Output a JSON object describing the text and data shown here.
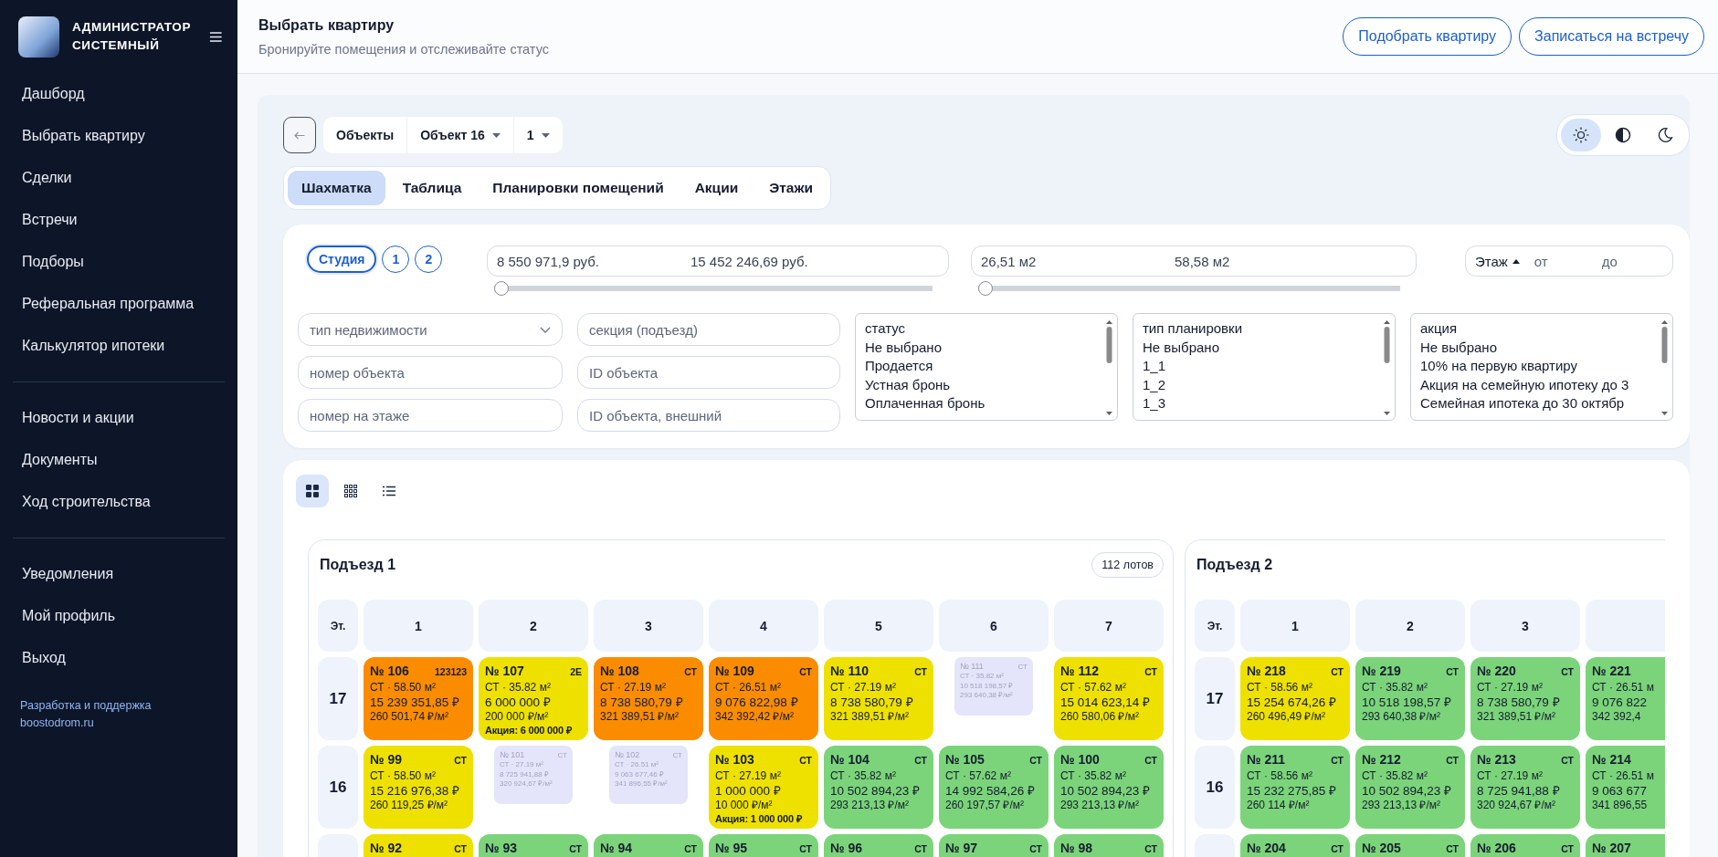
{
  "sidebar": {
    "user_name": "АДМИНИСТРАТОР СИСТЕМНЫЙ",
    "groups": [
      [
        {
          "label": "Дашборд"
        },
        {
          "label": "Выбрать квартиру"
        },
        {
          "label": "Сделки"
        },
        {
          "label": "Встречи"
        },
        {
          "label": "Подборы"
        },
        {
          "label": "Реферальная программа"
        },
        {
          "label": "Калькулятор ипотеки"
        }
      ],
      [
        {
          "label": "Новости и акции"
        },
        {
          "label": "Документы"
        },
        {
          "label": "Ход строительства"
        }
      ],
      [
        {
          "label": "Уведомления"
        },
        {
          "label": "Мой профиль"
        },
        {
          "label": "Выход"
        }
      ]
    ],
    "footer_link": "Разработка и поддержка boostodrom.ru"
  },
  "header": {
    "title": "Выбрать квартиру",
    "subtitle": "Бронируйте помещения и отслеживайте статус",
    "buttons": [
      "Подобрать квартиру",
      "Записаться на встречу"
    ]
  },
  "breadcrumb": [
    {
      "label": "Объекты",
      "dropdown": false
    },
    {
      "label": "Объект 16",
      "dropdown": true
    },
    {
      "label": "1",
      "dropdown": true
    }
  ],
  "themes": [
    {
      "kind": "sun",
      "selected": true
    },
    {
      "kind": "contrast",
      "selected": false
    },
    {
      "kind": "moon",
      "selected": false
    }
  ],
  "tabs": [
    {
      "label": "Шахматка",
      "selected": true
    },
    {
      "label": "Таблица",
      "selected": false
    },
    {
      "label": "Планировки помещений",
      "selected": false
    },
    {
      "label": "Акции",
      "selected": false
    },
    {
      "label": "Этажи",
      "selected": false
    }
  ],
  "filters": {
    "room_chips": [
      {
        "label": "Студия",
        "selected": true
      },
      {
        "label": "1",
        "selected": false
      },
      {
        "label": "2",
        "selected": false
      }
    ],
    "price_range": {
      "min": "8 550 971,9 руб.",
      "max": "15 452 246,69 руб.",
      "level": 0
    },
    "area_range": {
      "min": "26,51 м2",
      "max": "58,58 м2",
      "level": 0
    },
    "floor": {
      "label": "Этаж",
      "from_placeholder": "от",
      "to_placeholder": "до"
    },
    "fields": [
      {
        "kind": "select",
        "placeholder": "тип недвижимости"
      },
      {
        "kind": "input",
        "placeholder": "секция (подъезд)"
      },
      {
        "kind": "input",
        "placeholder": "номер объекта"
      },
      {
        "kind": "input",
        "placeholder": "ID объекта"
      },
      {
        "kind": "input",
        "placeholder": "номер на этаже"
      },
      {
        "kind": "input",
        "placeholder": "ID объекта, внешний"
      }
    ],
    "listboxes": [
      {
        "options": [
          "статус",
          "Не выбрано",
          "Продается",
          "Устная бронь",
          "Оплаченная бронь"
        ]
      },
      {
        "options": [
          "тип планировки",
          "Не выбрано",
          "1_1",
          "1_2",
          "1_3"
        ]
      },
      {
        "options": [
          "акция",
          "Не выбрано",
          "10% на первую квартиру",
          "Акция на семейную ипотеку до 3",
          "Семейная ипотека до 30 октябр"
        ]
      }
    ]
  },
  "view_modes": [
    {
      "kind": "grid",
      "selected": true
    },
    {
      "kind": "dense-grid",
      "selected": false
    },
    {
      "kind": "list",
      "selected": false
    }
  ],
  "sections": [
    {
      "title": "Подъезд 1",
      "badge": "112 лотов",
      "floor_header": "Эт.",
      "columns": [
        "1",
        "2",
        "3",
        "4",
        "5",
        "6",
        "7"
      ],
      "rows": [
        {
          "floor": "17",
          "lots": [
            {
              "number": "№ 106",
              "tag": "123123",
              "area": "СТ · 58.50 м²",
              "price": "15 239 351,85 ₽",
              "per_m2": "260 501,74 ₽/м²",
              "color": "#fb8c00",
              "disabled": false
            },
            {
              "number": "№ 107",
              "tag": "2Е",
              "area": "СТ · 35.82 м²",
              "price": "6 000 000 ₽",
              "per_m2": "200 000 ₽/м²",
              "promo": "Акция: 6 000 000 ₽",
              "color": "#eee100",
              "disabled": false
            },
            {
              "number": "№ 108",
              "tag": "СТ",
              "area": "СТ · 27.19 м²",
              "price": "8 738 580,79 ₽",
              "per_m2": "321 389,51 ₽/м²",
              "color": "#fb8c00",
              "disabled": false
            },
            {
              "number": "№ 109",
              "tag": "СТ",
              "area": "СТ · 26.51 м²",
              "price": "9 076 822,98 ₽",
              "per_m2": "342 392,42 ₽/м²",
              "color": "#fb8c00",
              "disabled": false
            },
            {
              "number": "№ 110",
              "tag": "СТ",
              "area": "СТ · 27.19 м²",
              "price": "8 738 580,79 ₽",
              "per_m2": "321 389,51 ₽/м²",
              "color": "#eee100",
              "disabled": false
            },
            {
              "number": "№ 111",
              "tag": "СТ",
              "area": "СТ · 35.82 м²",
              "price": "10 518 198,57 ₽",
              "per_m2": "293 640,38 ₽/м²",
              "color": "#e4e4fb",
              "disabled": true
            },
            {
              "number": "№ 112",
              "tag": "СТ",
              "area": "СТ · 57.62 м²",
              "price": "15 014 623,14 ₽",
              "per_m2": "260 580,06 ₽/м²",
              "color": "#eee100",
              "disabled": false
            }
          ]
        },
        {
          "floor": "16",
          "lots": [
            {
              "number": "№ 99",
              "tag": "СТ",
              "area": "СТ · 58.50 м²",
              "price": "15 216 976,38 ₽",
              "per_m2": "260 119,25 ₽/м²",
              "color": "#eee100",
              "disabled": false
            },
            {
              "number": "№ 101",
              "tag": "СТ",
              "area": "СТ · 27.19 м²",
              "price": "8 725 941,88 ₽",
              "per_m2": "320 924,67 ₽/м²",
              "color": "#e4e4fb",
              "disabled": true
            },
            {
              "number": "№ 102",
              "tag": "СТ",
              "area": "СТ · 26.51 м²",
              "price": "9 063 677,46 ₽",
              "per_m2": "341 896,55 ₽/м²",
              "color": "#e4e4fb",
              "disabled": true
            },
            {
              "number": "№ 103",
              "tag": "СТ",
              "area": "СТ · 27.19 м²",
              "price": "1 000 000 ₽",
              "per_m2": "10 000 ₽/м²",
              "promo": "Акция: 1 000 000 ₽",
              "color": "#eee100",
              "disabled": false
            },
            {
              "number": "№ 104",
              "tag": "СТ",
              "area": "СТ · 35.82 м²",
              "price": "10 502 894,23 ₽",
              "per_m2": "293 213,13 ₽/м²",
              "color": "#7bd47a",
              "disabled": false
            },
            {
              "number": "№ 105",
              "tag": "СТ",
              "area": "СТ · 57.62 м²",
              "price": "14 992 584,26 ₽",
              "per_m2": "260 197,57 ₽/м²",
              "color": "#7bd47a",
              "disabled": false
            },
            {
              "number": "№ 100",
              "tag": "СТ",
              "area": "СТ · 35.82 м²",
              "price": "10 502 894,23 ₽",
              "per_m2": "293 213,13 ₽/м²",
              "color": "#7bd47a",
              "disabled": false
            }
          ]
        },
        {
          "lots": [
            {
              "number": "№ 92",
              "tag": "СТ",
              "color": "#eee100",
              "disabled": false
            },
            {
              "number": "№ 93",
              "tag": "СТ",
              "color": "#7bd47a",
              "disabled": false
            },
            {
              "number": "№ 94",
              "tag": "СТ",
              "color": "#7bd47a",
              "disabled": false
            },
            {
              "number": "№ 95",
              "tag": "СТ",
              "color": "#7bd47a",
              "disabled": false
            },
            {
              "number": "№ 96",
              "tag": "СТ",
              "color": "#7bd47a",
              "disabled": false
            },
            {
              "number": "№ 97",
              "tag": "СТ",
              "color": "#7bd47a",
              "disabled": false
            },
            {
              "number": "№ 98",
              "tag": "СТ",
              "color": "#7bd47a",
              "disabled": false
            }
          ]
        }
      ]
    },
    {
      "title": "Подъезд 2",
      "floor_header": "Эт.",
      "columns": [
        "1",
        "2",
        "3"
      ],
      "rows": [
        {
          "floor": "17",
          "lots": [
            {
              "number": "№ 218",
              "tag": "СТ",
              "area": "СТ · 58.56 м²",
              "price": "15 254 674,26 ₽",
              "per_m2": "260 496,49 ₽/м²",
              "color": "#eee100",
              "disabled": false
            },
            {
              "number": "№ 219",
              "tag": "СТ",
              "area": "СТ · 35.82 м²",
              "price": "10 518 198,57 ₽",
              "per_m2": "293 640,38 ₽/м²",
              "color": "#7bd47a",
              "disabled": false
            },
            {
              "number": "№ 220",
              "tag": "СТ",
              "area": "СТ · 27.19 м²",
              "price": "8 738 580,79 ₽",
              "per_m2": "321 389,51 ₽/м²",
              "color": "#7bd47a",
              "disabled": false
            },
            {
              "number": "№ 221",
              "area": "СТ · 26.51 м",
              "price": "9 076 822",
              "per_m2": "342 392,4",
              "color": "#7bd47a",
              "disabled": false
            }
          ]
        },
        {
          "floor": "16",
          "lots": [
            {
              "number": "№ 211",
              "tag": "СТ",
              "area": "СТ · 58.56 м²",
              "price": "15 232 275,85 ₽",
              "per_m2": "260 114 ₽/м²",
              "color": "#7bd47a",
              "disabled": false
            },
            {
              "number": "№ 212",
              "tag": "СТ",
              "area": "СТ · 35.82 м²",
              "price": "10 502 894,23 ₽",
              "per_m2": "293 213,13 ₽/м²",
              "color": "#7bd47a",
              "disabled": false
            },
            {
              "number": "№ 213",
              "tag": "СТ",
              "area": "СТ · 27.19 м²",
              "price": "8 725 941,88 ₽",
              "per_m2": "320 924,67 ₽/м²",
              "color": "#7bd47a",
              "disabled": false
            },
            {
              "number": "№ 214",
              "area": "СТ · 26.51 м",
              "price": "9 063 677",
              "per_m2": "341 896,55",
              "color": "#7bd47a",
              "disabled": false
            }
          ]
        },
        {
          "lots": [
            {
              "number": "№ 204",
              "tag": "СТ",
              "color": "#7bd47a",
              "disabled": false
            },
            {
              "number": "№ 205",
              "tag": "СТ",
              "color": "#7bd47a",
              "disabled": false
            },
            {
              "number": "№ 206",
              "tag": "СТ",
              "color": "#7bd47a",
              "disabled": false
            },
            {
              "number": "№ 207",
              "color": "#7bd47a",
              "disabled": false
            }
          ]
        }
      ]
    }
  ]
}
